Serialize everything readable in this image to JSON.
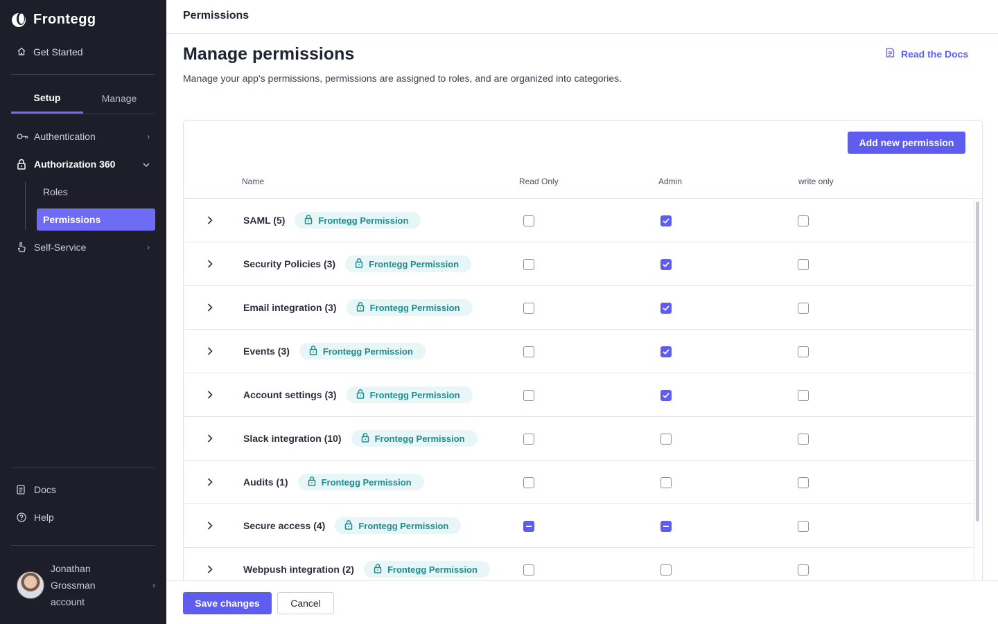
{
  "app": {
    "brand": "Frontegg"
  },
  "sidebar": {
    "get_started": "Get Started",
    "tabs": [
      {
        "label": "Setup",
        "active": true
      },
      {
        "label": "Manage",
        "active": false
      }
    ],
    "items": [
      {
        "label": "Authentication",
        "icon": "key-icon"
      },
      {
        "label": "Authorization 360",
        "icon": "lock-icon",
        "expanded": true
      },
      {
        "label": "Self-Service",
        "icon": "hand-pointer-icon"
      }
    ],
    "sub_items": [
      {
        "label": "Roles",
        "active": false
      },
      {
        "label": "Permissions",
        "active": true
      }
    ],
    "docs": "Docs",
    "help": "Help",
    "user": {
      "name": "Jonathan Grossman account"
    }
  },
  "header": {
    "title": "Permissions"
  },
  "main": {
    "title": "Manage permissions",
    "subtitle": "Manage your app's permissions, permissions are assigned to roles, and are organized into categories.",
    "docs_link": "Read the Docs",
    "add_button": "Add new permission",
    "columns": {
      "name": "Name",
      "read_only": "Read Only",
      "admin": "Admin",
      "write_only": "write only"
    },
    "rows": [
      {
        "name": "SAML (5)",
        "badge": "Frontegg Permission",
        "read_only": "unchecked",
        "admin": "checked",
        "write_only": "unchecked"
      },
      {
        "name": "Security Policies (3)",
        "badge": "Frontegg Permission",
        "read_only": "unchecked",
        "admin": "checked",
        "write_only": "unchecked"
      },
      {
        "name": "Email integration (3)",
        "badge": "Frontegg Permission",
        "read_only": "unchecked",
        "admin": "checked",
        "write_only": "unchecked"
      },
      {
        "name": "Events (3)",
        "badge": "Frontegg Permission",
        "read_only": "unchecked",
        "admin": "checked",
        "write_only": "unchecked"
      },
      {
        "name": "Account settings (3)",
        "badge": "Frontegg Permission",
        "read_only": "unchecked",
        "admin": "checked",
        "write_only": "unchecked"
      },
      {
        "name": "Slack integration (10)",
        "badge": "Frontegg Permission",
        "read_only": "unchecked",
        "admin": "unchecked",
        "write_only": "unchecked"
      },
      {
        "name": "Audits (1)",
        "badge": "Frontegg Permission",
        "read_only": "unchecked",
        "admin": "unchecked",
        "write_only": "unchecked"
      },
      {
        "name": "Secure access (4)",
        "badge": "Frontegg Permission",
        "read_only": "partial",
        "admin": "partial",
        "write_only": "unchecked"
      },
      {
        "name": "Webpush integration (2)",
        "badge": "Frontegg Permission",
        "read_only": "unchecked",
        "admin": "unchecked",
        "write_only": "unchecked"
      }
    ]
  },
  "footer": {
    "save": "Save changes",
    "cancel": "Cancel"
  },
  "colors": {
    "accent": "#5f5cf0",
    "sidebar_bg": "#1d1e2a",
    "badge_bg": "#e8f6f7",
    "badge_text": "#1e8c8f"
  }
}
